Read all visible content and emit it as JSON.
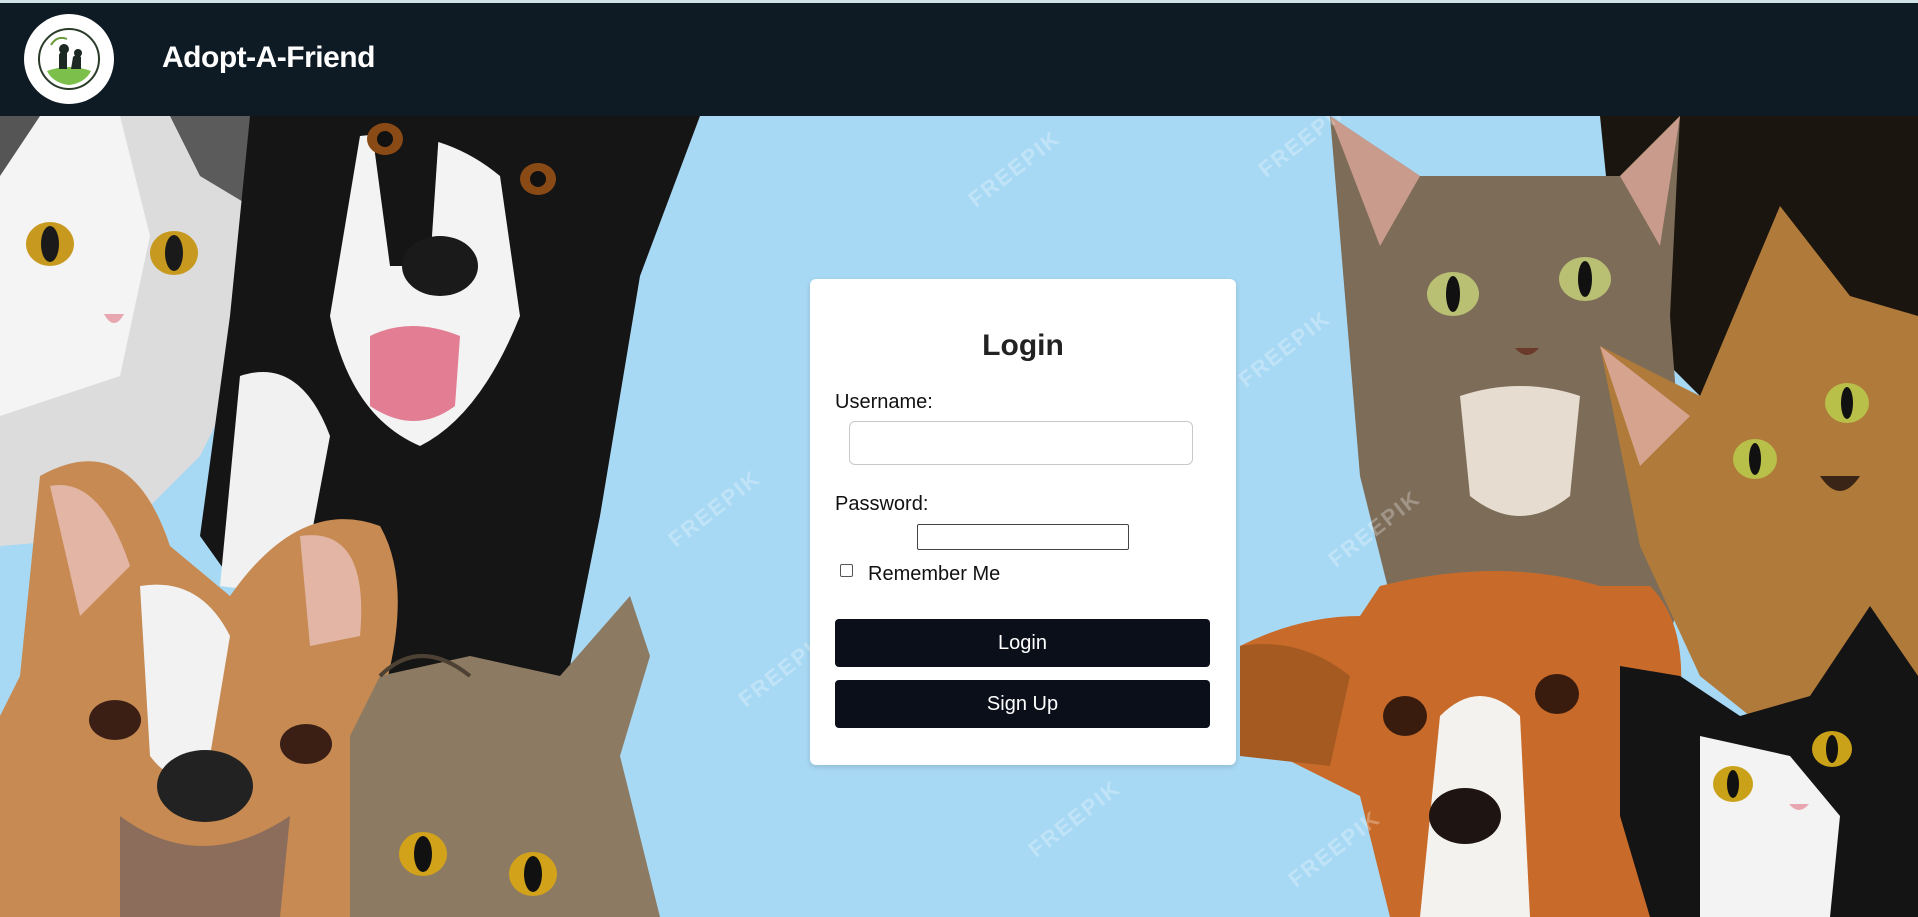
{
  "navbar": {
    "brand": "Adopt-A-Friend",
    "logo_icon": "pet-adoption-logo-icon"
  },
  "hero": {
    "watermark": "FREEPIK"
  },
  "login": {
    "title": "Login",
    "username_label": "Username:",
    "username_value": "",
    "password_label": "Password:",
    "password_value": "",
    "remember_label": "Remember Me",
    "remember_checked": false,
    "login_button": "Login",
    "signup_button": "Sign Up"
  },
  "colors": {
    "navbar_bg": "#0f1b24",
    "hero_bg": "#a8d9f4",
    "button_bg": "#0b0f1a",
    "card_bg": "#ffffff"
  }
}
